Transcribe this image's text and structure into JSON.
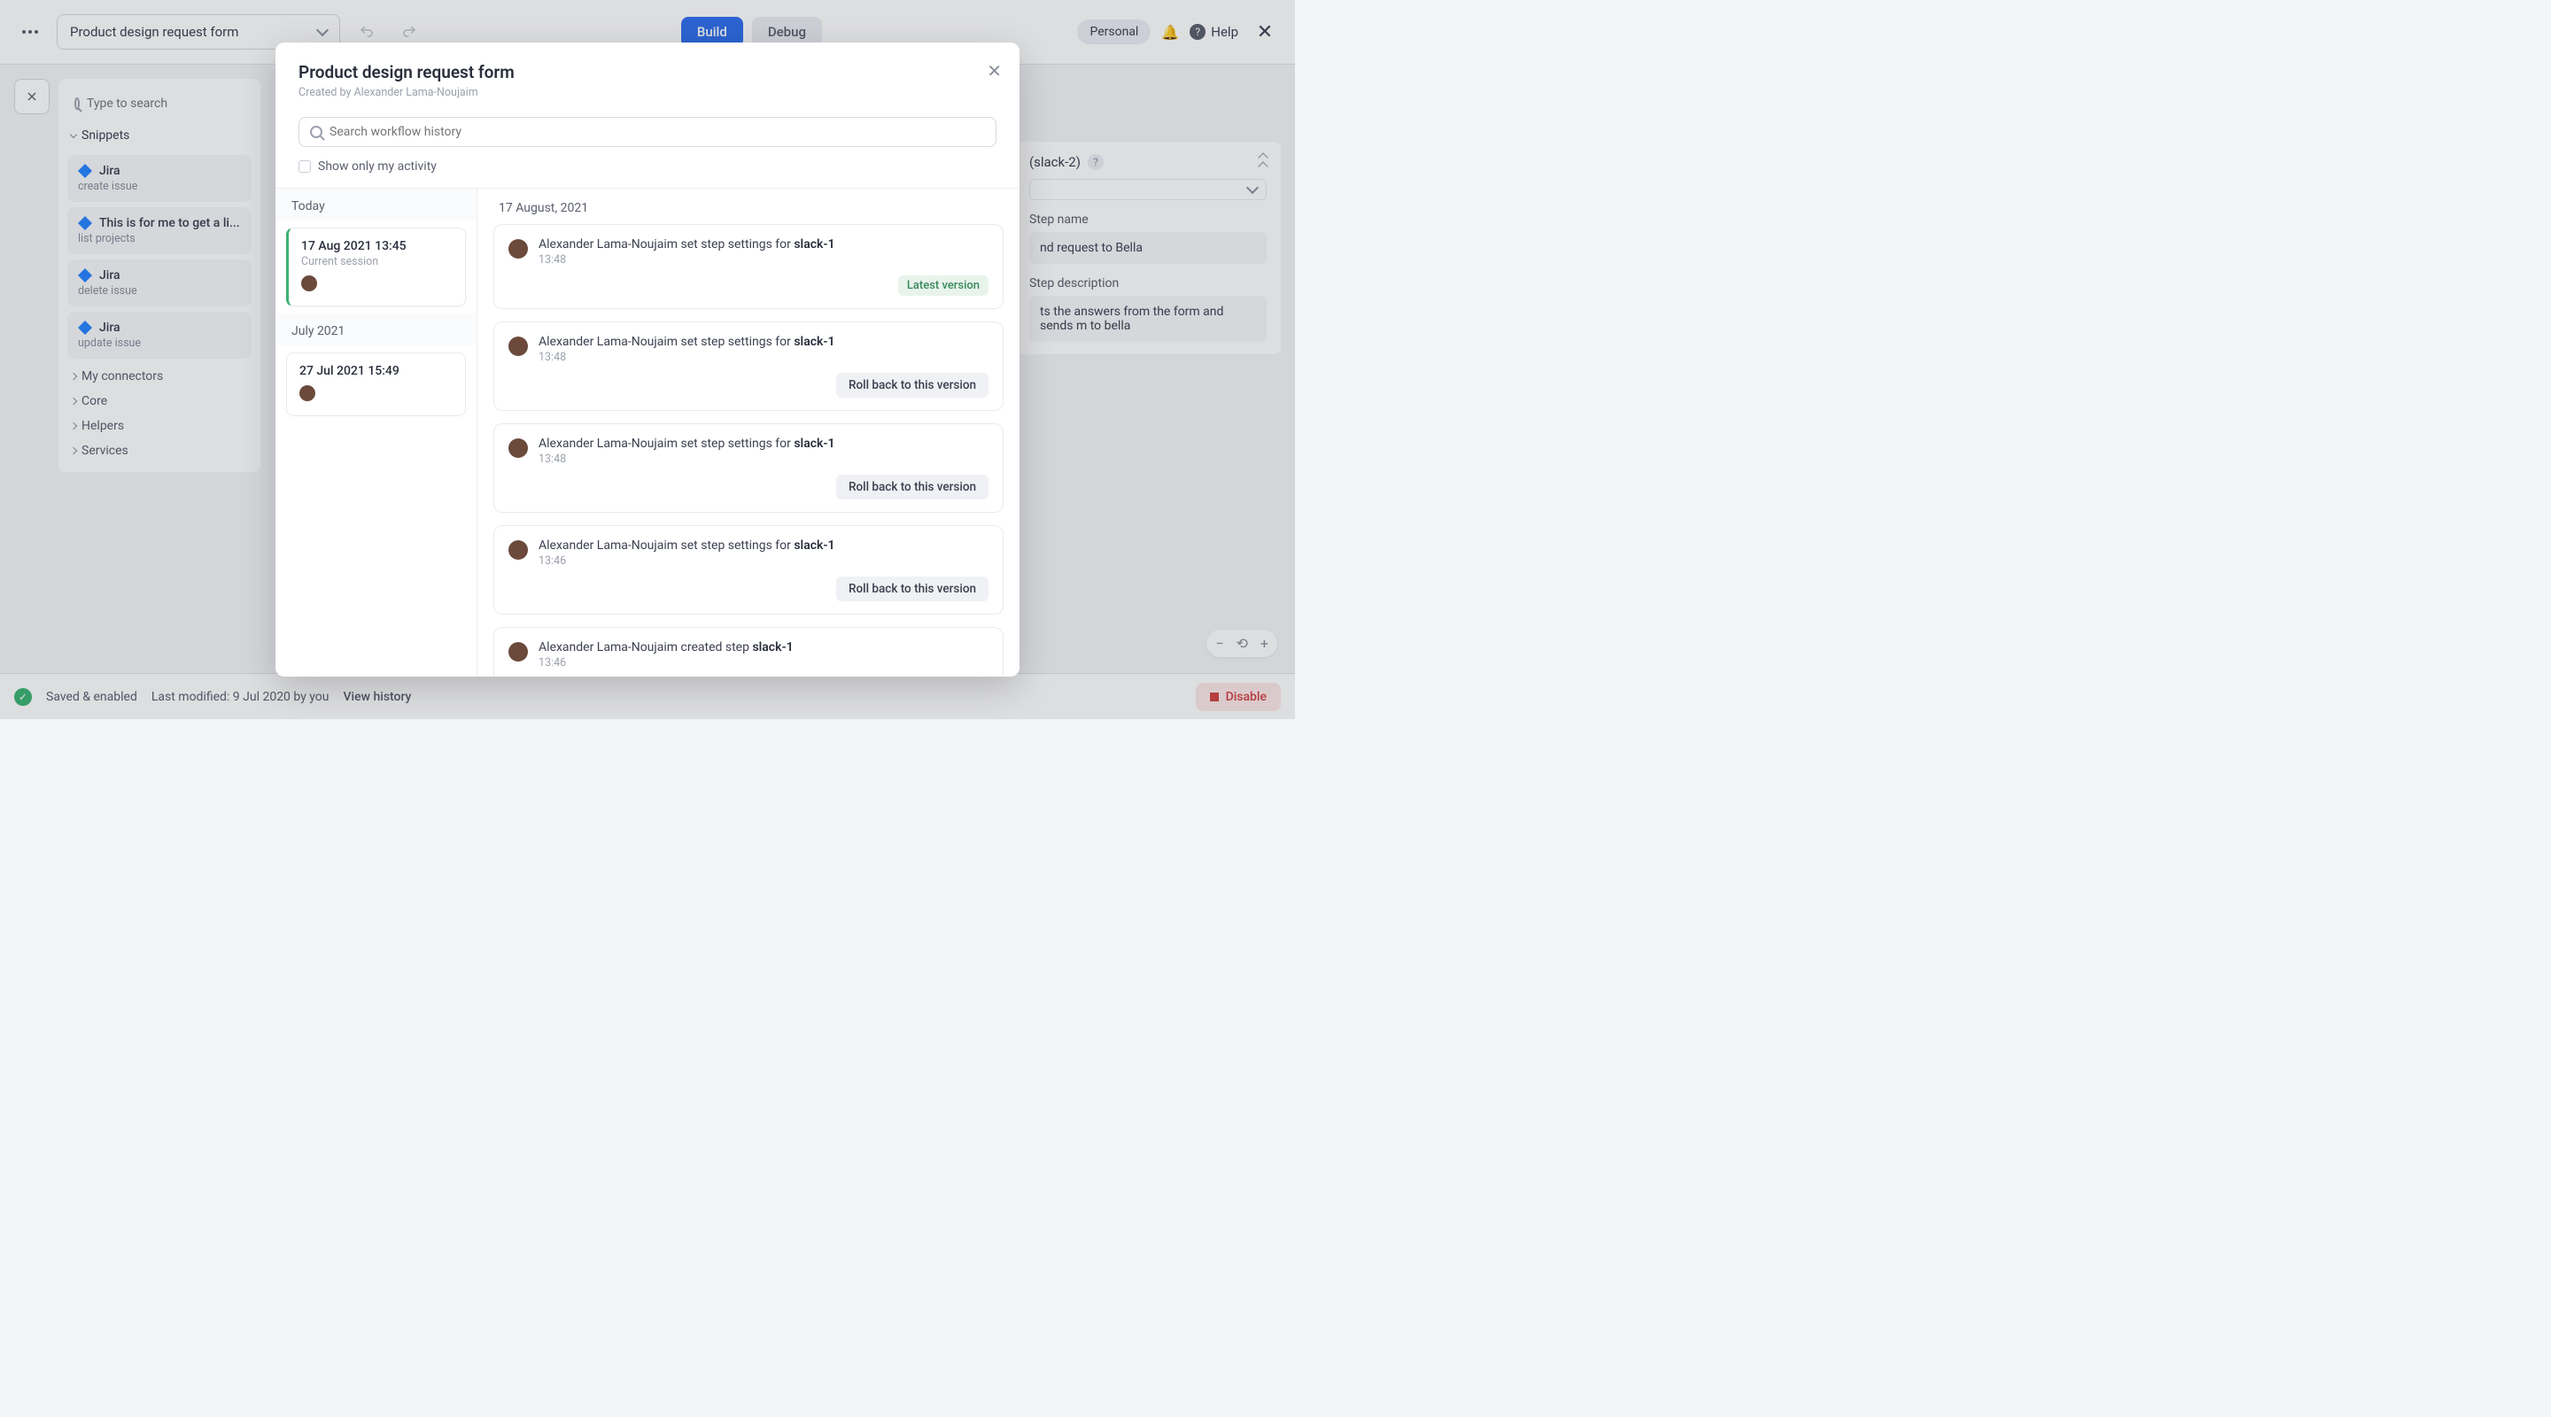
{
  "topbar": {
    "form_title": "Product design request form",
    "build": "Build",
    "debug": "Debug",
    "plan": "Personal",
    "help": "Help"
  },
  "sidebar": {
    "search_placeholder": "Type to search",
    "group": "Snippets",
    "snippets": [
      {
        "title": "Jira",
        "sub": "create issue"
      },
      {
        "title": "This is for me to get a li...",
        "sub": "list projects"
      },
      {
        "title": "Jira",
        "sub": "delete issue"
      },
      {
        "title": "Jira",
        "sub": "update issue"
      }
    ],
    "tree": [
      "My connectors",
      "Core",
      "Helpers",
      "Services"
    ]
  },
  "right": {
    "head": "(slack-2)",
    "name_label": "Step name",
    "name_value": "nd request to Bella",
    "desc_label": "Step description",
    "desc_value": "ts the answers from the form and sends m to bella"
  },
  "bottom": {
    "saved": "Saved & enabled",
    "modified": "Last modified: 9 Jul 2020 by you",
    "view_history": "View history",
    "disable": "Disable"
  },
  "modal": {
    "title": "Product design request form",
    "created_by": "Created by Alexander Lama-Noujaim",
    "search_placeholder": "Search workflow history",
    "show_only": "Show only my activity",
    "groups": [
      {
        "label": "Today",
        "sessions": [
          {
            "dt": "17 Aug 2021 13:45",
            "cs": "Current session",
            "active": true
          }
        ]
      },
      {
        "label": "July 2021",
        "sessions": [
          {
            "dt": "27 Jul 2021 15:49",
            "cs": "",
            "active": false
          }
        ]
      }
    ],
    "events_date": "17 August, 2021",
    "latest_label": "Latest version",
    "rollback_label": "Roll back to this version",
    "events": [
      {
        "actor": "Alexander Lama-Noujaim",
        "action": "set step settings for",
        "target": "slack-1",
        "time": "13:48",
        "latest": true
      },
      {
        "actor": "Alexander Lama-Noujaim",
        "action": "set step settings for",
        "target": "slack-1",
        "time": "13:48",
        "latest": false
      },
      {
        "actor": "Alexander Lama-Noujaim",
        "action": "set step settings for",
        "target": "slack-1",
        "time": "13:48",
        "latest": false
      },
      {
        "actor": "Alexander Lama-Noujaim",
        "action": "set step settings for",
        "target": "slack-1",
        "time": "13:46",
        "latest": false
      },
      {
        "actor": "Alexander Lama-Noujaim",
        "action": "created step",
        "target": "slack-1",
        "time": "13:46",
        "latest": false,
        "no_footer": true
      }
    ]
  }
}
